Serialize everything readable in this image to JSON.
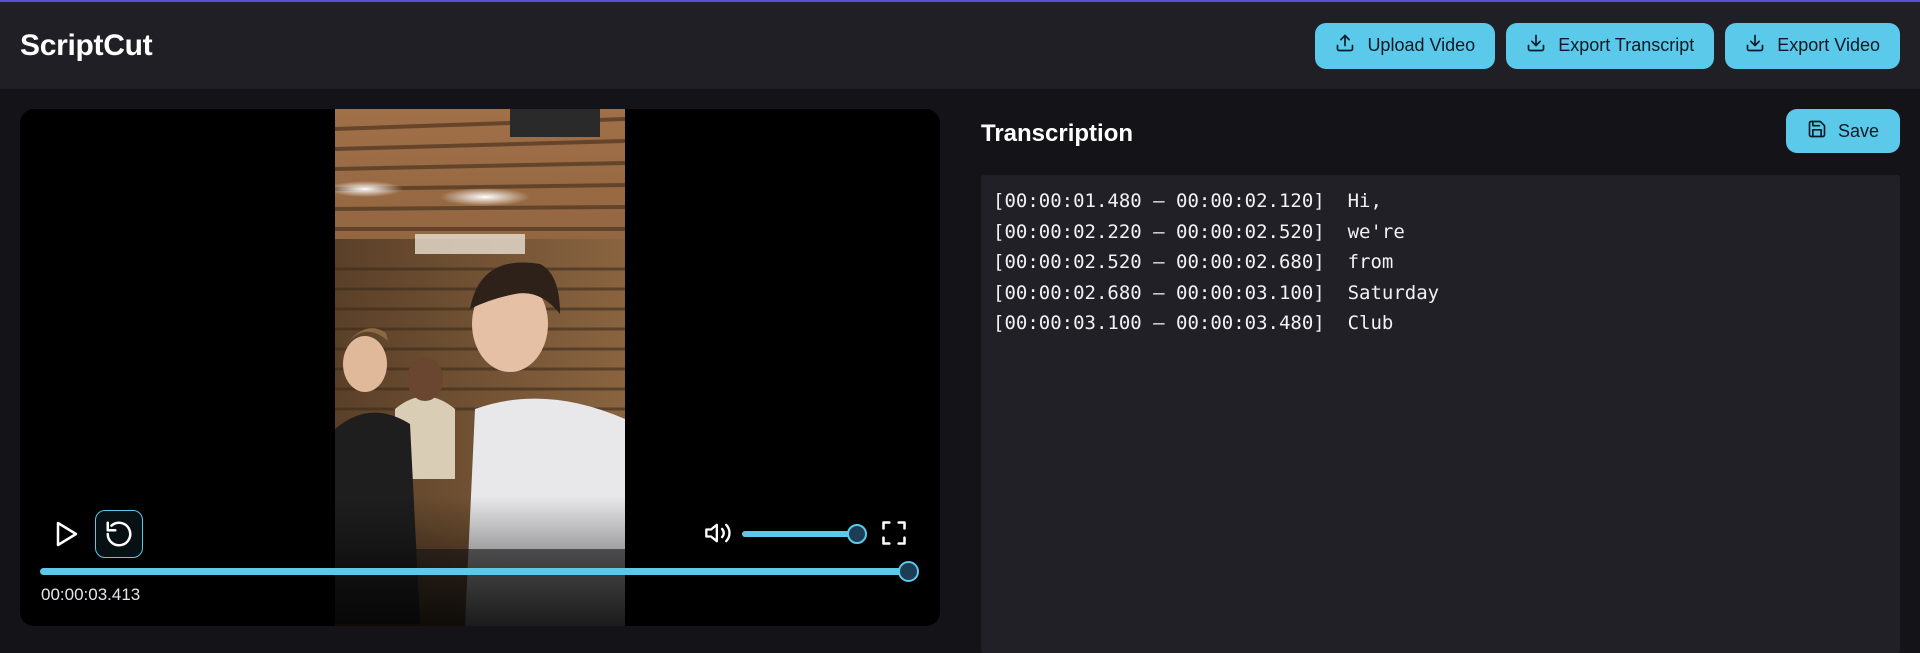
{
  "app": {
    "title": "ScriptCut"
  },
  "header": {
    "upload_label": "Upload Video",
    "export_transcript_label": "Export Transcript",
    "export_video_label": "Export Video"
  },
  "player": {
    "current_time": "00:00:03.413",
    "progress_fraction": 1.0,
    "volume_fraction": 1.0,
    "state": "paused"
  },
  "transcription": {
    "title": "Transcription",
    "save_label": "Save",
    "segments": [
      {
        "start": "00:00:01.480",
        "end": "00:00:02.120",
        "text": "Hi,"
      },
      {
        "start": "00:00:02.220",
        "end": "00:00:02.520",
        "text": "we're"
      },
      {
        "start": "00:00:02.520",
        "end": "00:00:02.680",
        "text": "from"
      },
      {
        "start": "00:00:02.680",
        "end": "00:00:03.100",
        "text": "Saturday"
      },
      {
        "start": "00:00:03.100",
        "end": "00:00:03.480",
        "text": "Club"
      }
    ]
  },
  "colors": {
    "accent": "#5bc9ea",
    "header_bg": "#1f1f25",
    "page_bg": "#131318",
    "panel_bg": "#202026"
  },
  "icons": {
    "upload": "upload-icon",
    "export_transcript": "download-icon",
    "export_video": "download-icon",
    "save": "floppy-disk-icon",
    "play": "play-icon",
    "replay": "replay-icon",
    "volume": "volume-icon",
    "fullscreen": "fullscreen-icon"
  }
}
